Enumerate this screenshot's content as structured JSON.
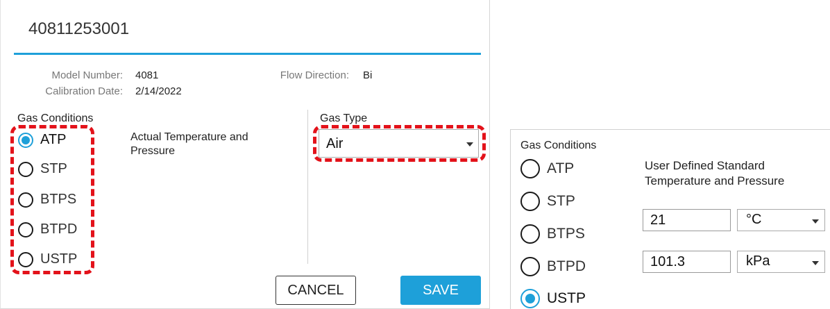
{
  "dialog": {
    "serial": "40811253001",
    "meta": {
      "model_label": "Model Number:",
      "model_value": "4081",
      "cal_label": "Calibration Date:",
      "cal_value": "2/14/2022",
      "flow_label": "Flow Direction:",
      "flow_value": "Bi"
    },
    "gas_conditions_title": "Gas Conditions",
    "options": [
      {
        "label": "ATP",
        "selected": true
      },
      {
        "label": "STP",
        "selected": false
      },
      {
        "label": "BTPS",
        "selected": false
      },
      {
        "label": "BTPD",
        "selected": false
      },
      {
        "label": "USTP",
        "selected": false
      }
    ],
    "description": "Actual Temperature and Pressure",
    "gas_type_title": "Gas Type",
    "gas_type_value": "Air",
    "cancel_label": "CANCEL",
    "save_label": "SAVE"
  },
  "panel2": {
    "gas_conditions_title": "Gas Conditions",
    "options": [
      {
        "label": "ATP",
        "selected": false
      },
      {
        "label": "STP",
        "selected": false
      },
      {
        "label": "BTPS",
        "selected": false
      },
      {
        "label": "BTPD",
        "selected": false
      },
      {
        "label": "USTP",
        "selected": true
      }
    ],
    "description": "User Defined Standard Temperature and Pressure",
    "temperature_value": "21",
    "temperature_unit": "°C",
    "pressure_value": "101.3",
    "pressure_unit": "kPa"
  },
  "colors": {
    "accent": "#1ea0d9",
    "highlight": "#e3121a"
  }
}
